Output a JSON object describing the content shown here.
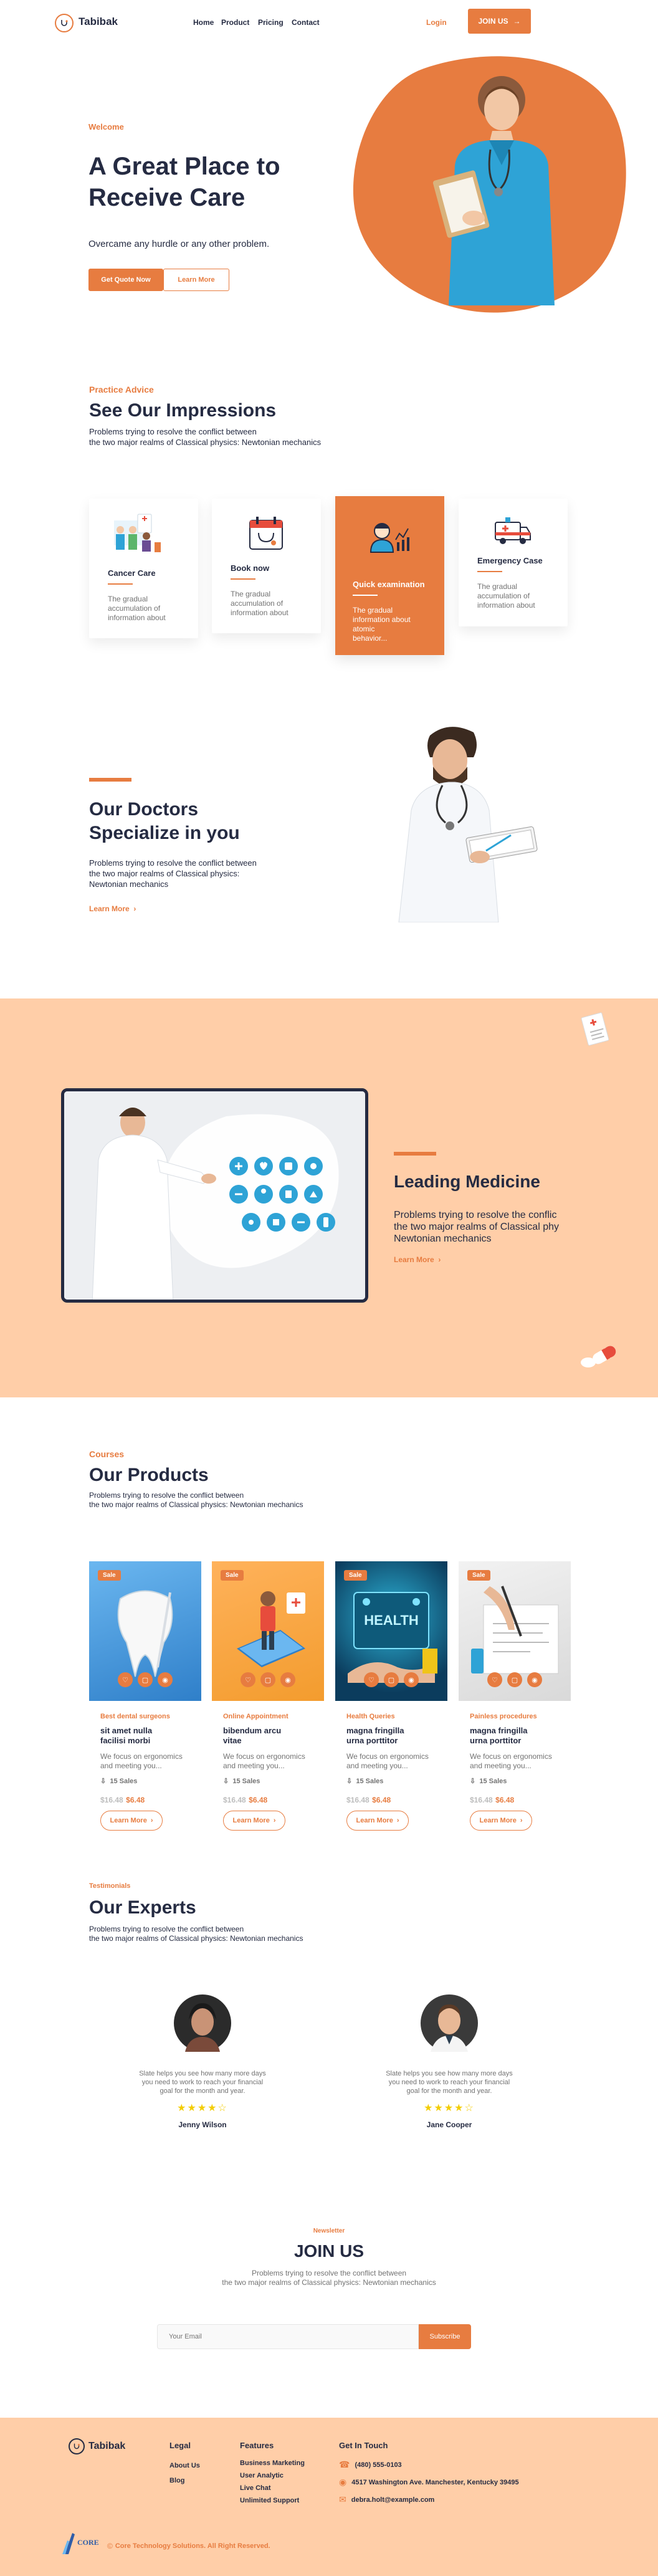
{
  "header": {
    "brand": "Tabibak",
    "nav": [
      "Home",
      "Product",
      "Pricing",
      "Contact"
    ],
    "login": "Login",
    "join": "JOIN US"
  },
  "hero": {
    "eyebrow": "Welcome",
    "title_line1": "A Great Place to",
    "title_line2": "Receive Care",
    "subtitle": "Overcame any hurdle or any other problem.",
    "btn_primary": "Get Quote Now",
    "btn_secondary": "Learn More"
  },
  "impressions": {
    "eyebrow": "Practice Advice",
    "title": "See Our Impressions",
    "desc_line1": "Problems trying to resolve the conflict between",
    "desc_line2": "the two major realms of Classical physics: Newtonian mechanics",
    "cards": [
      {
        "title": "Cancer Care",
        "text_1": "The gradual",
        "text_2": "accumulation of",
        "text_3": "information about",
        "text_4": "",
        "icon": "medical-team-icon"
      },
      {
        "title": "Book now",
        "text_1": "The gradual",
        "text_2": "accumulation of",
        "text_3": "information about",
        "text_4": "",
        "icon": "calendar-stethoscope-icon"
      },
      {
        "title": "Quick examination",
        "text_1": "The gradual",
        "text_2": "information about",
        "text_3": "atomic",
        "text_4": "behavior...",
        "icon": "doctor-chart-icon"
      },
      {
        "title": "Emergency Case",
        "text_1": "The gradual",
        "text_2": "accumulation of",
        "text_3": "information about",
        "text_4": "",
        "icon": "ambulance-icon"
      }
    ]
  },
  "doctors": {
    "title_line1": "Our Doctors",
    "title_line2": "Specialize in you",
    "desc_line1": "Problems trying to resolve the conflict between",
    "desc_line2": "the two major realms of Classical physics:",
    "desc_line3": "Newtonian mechanics",
    "link": "Learn More"
  },
  "medicine": {
    "title": "Leading Medicine",
    "desc_line1": "Problems trying to resolve the conflic",
    "desc_line2": "the two major realms of Classical phy",
    "desc_line3": "Newtonian mechanics",
    "link": "Learn More"
  },
  "products": {
    "eyebrow": "Courses",
    "title": "Our Products",
    "desc_line1": "Problems trying to resolve the conflict between",
    "desc_line2": "the two major realms of Classical physics: Newtonian mechanics",
    "sale_label": "Sale",
    "items": [
      {
        "category": "Best dental surgeons",
        "title_1": "sit amet nulla",
        "title_2": "facilisi morbi",
        "desc_1": "We focus on ergonomics",
        "desc_2": "and meeting you...",
        "sales": "15 Sales",
        "old_price": "$16.48",
        "new_price": "$6.48",
        "button": "Learn More"
      },
      {
        "category": "Online Appointment",
        "title_1": "bibendum arcu",
        "title_2": "vitae",
        "desc_1": "We focus on ergonomics",
        "desc_2": "and meeting you...",
        "sales": "15 Sales",
        "old_price": "$16.48",
        "new_price": "$6.48",
        "button": "Learn More"
      },
      {
        "category": "Health Queries",
        "title_1": "magna fringilla",
        "title_2": "urna porttitor",
        "desc_1": "We focus on ergonomics",
        "desc_2": "and meeting you...",
        "sales": "15 Sales",
        "old_price": "$16.48",
        "new_price": "$6.48",
        "button": "Learn More"
      },
      {
        "category": "Painless procedures",
        "title_1": "magna fringilla",
        "title_2": "urna porttitor",
        "desc_1": "We focus on ergonomics",
        "desc_2": "and meeting you...",
        "sales": "15 Sales",
        "old_price": "$16.48",
        "new_price": "$6.48",
        "button": "Learn More"
      }
    ]
  },
  "experts": {
    "eyebrow": "Testimonials",
    "title": "Our Experts",
    "desc_line1": "Problems trying to resolve the conflict between",
    "desc_line2": "the two major realms of Classical physics: Newtonian mechanics",
    "people": [
      {
        "name": "Jenny Wilson",
        "text_1": "Slate helps you see how many more days",
        "text_2": "you need to work to reach your financial",
        "text_3": "goal for the month and year.",
        "rating": 4
      },
      {
        "name": "Jane Cooper",
        "text_1": "Slate helps you see how many more days",
        "text_2": "you need to work to reach your financial",
        "text_3": "goal for the month and year.",
        "rating": 4
      }
    ]
  },
  "newsletter": {
    "eyebrow": "Newsletter",
    "title": "JOIN US",
    "desc_line1": "Problems trying to resolve the conflict between",
    "desc_line2": "the two major realms of Classical physics: Newtonian mechanics",
    "placeholder": "Your Email",
    "button": "Subscribe"
  },
  "footer": {
    "brand": "Tabibak",
    "legal_title": "Legal",
    "legal_links": [
      "About Us",
      "Blog"
    ],
    "features_title": "Features",
    "features_links": [
      "Business Marketing",
      "User Analytic",
      "Live Chat",
      "Unlimited Support"
    ],
    "contact_title": "Get In Touch",
    "phone": "(480) 555-0103",
    "address": "4517 Washington Ave. Manchester, Kentucky 39495",
    "email": "debra.holt@example.com",
    "logo_text": "CORE",
    "credit": "Core Technology Solutions. All Right Reserved."
  },
  "colors": {
    "accent": "#E77C40",
    "peach": "#FFCEA8",
    "dark": "#252B42",
    "muted": "#737373"
  }
}
